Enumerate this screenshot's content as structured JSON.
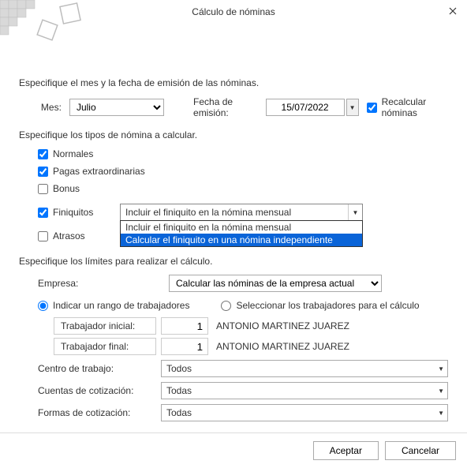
{
  "window": {
    "title": "Cálculo de nóminas"
  },
  "section1": {
    "heading": "Especifique el mes y la fecha de emisión de las nóminas.",
    "mes_label": "Mes:",
    "mes_value": "Julio",
    "fecha_label": "Fecha de emisión:",
    "fecha_value": "15/07/2022",
    "recalc_label": "Recalcular nóminas",
    "recalc_checked": true
  },
  "section2": {
    "heading": "Especifique los tipos de nómina a calcular.",
    "types": {
      "normales": {
        "label": "Normales",
        "checked": true
      },
      "pagas": {
        "label": "Pagas extraordinarias",
        "checked": true
      },
      "bonus": {
        "label": "Bonus",
        "checked": false
      },
      "finiquitos": {
        "label": "Finiquitos",
        "checked": true
      },
      "atrasos": {
        "label": "Atrasos",
        "checked": false
      }
    },
    "fini_selected": "Incluir el finiquito en la nómina mensual",
    "fini_options": {
      "opt0": "Incluir el finiquito en la nómina mensual",
      "opt1": "Calcular el finiquito en una nómina independiente"
    }
  },
  "section3": {
    "heading": "Especifique los límites para realizar el cálculo.",
    "empresa_label": "Empresa:",
    "empresa_value": "Calcular las nóminas de la empresa actual",
    "radio_rango": "Indicar un rango de trabajadores",
    "radio_select": "Seleccionar los trabajadores para el cálculo",
    "worker_initial_label": "Trabajador inicial:",
    "worker_final_label": "Trabajador final:",
    "worker_initial_num": "1",
    "worker_final_num": "1",
    "worker_initial_name": "ANTONIO MARTINEZ JUAREZ",
    "worker_final_name": "ANTONIO MARTINEZ JUAREZ",
    "centro_label": "Centro de trabajo:",
    "centro_value": "Todos",
    "cuentas_label": "Cuentas de cotización:",
    "cuentas_value": "Todas",
    "formas_label": "Formas de cotización:",
    "formas_value": "Todas"
  },
  "footer": {
    "accept": "Aceptar",
    "cancel": "Cancelar"
  }
}
